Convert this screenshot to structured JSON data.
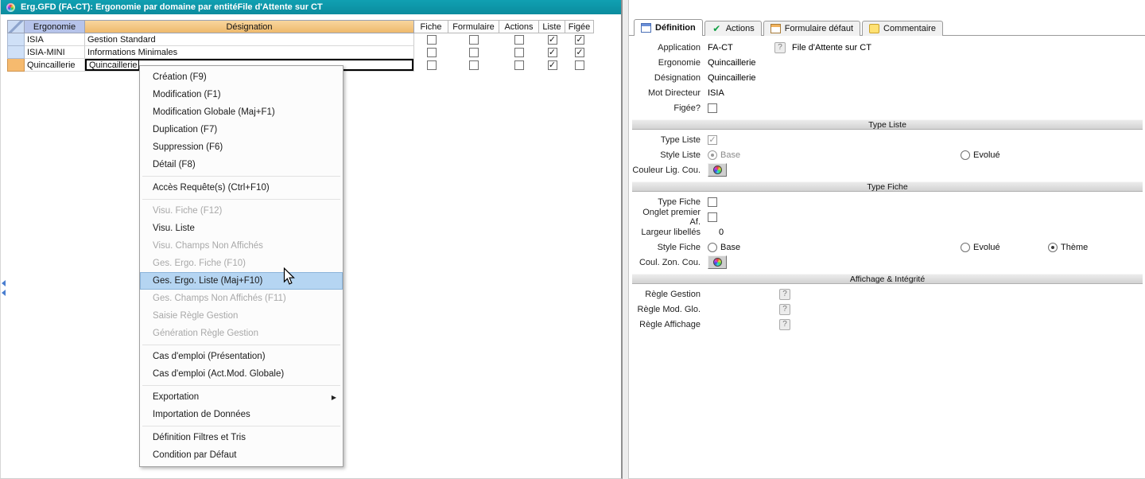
{
  "window": {
    "title": "Erg.GFD (FA-CT): Ergonomie par domaine par entitéFile d'Attente sur CT"
  },
  "glyphs": {
    "check": "✓",
    "check_bold": "✔",
    "submenu_arrow": "▶",
    "help": "?"
  },
  "table": {
    "columns": [
      "Ergonomie",
      "Désignation",
      "Fiche",
      "Formulaire",
      "Actions",
      "Liste",
      "Figée"
    ],
    "rows": [
      {
        "ergonomie": "ISIA",
        "designation": "Gestion Standard",
        "fiche": false,
        "formulaire": false,
        "actions": false,
        "liste": true,
        "figee": true,
        "selected": false,
        "editing": false
      },
      {
        "ergonomie": "ISIA-MINI",
        "designation": "Informations Minimales",
        "fiche": false,
        "formulaire": false,
        "actions": false,
        "liste": true,
        "figee": true,
        "selected": false,
        "editing": false
      },
      {
        "ergonomie": "Quincaillerie",
        "designation": "Quincaillerie",
        "fiche": false,
        "formulaire": false,
        "actions": false,
        "liste": true,
        "figee": false,
        "selected": true,
        "editing": true
      }
    ]
  },
  "context_menu": {
    "items": [
      {
        "label": "Création (F9)"
      },
      {
        "label": "Modification (F1)"
      },
      {
        "label": "Modification Globale (Maj+F1)"
      },
      {
        "label": "Duplication (F7)"
      },
      {
        "label": "Suppression (F6)"
      },
      {
        "label": "Détail (F8)"
      },
      {
        "separator": true
      },
      {
        "label": "Accès Requête(s) (Ctrl+F10)"
      },
      {
        "separator": true
      },
      {
        "label": "Visu. Fiche (F12)",
        "disabled": true
      },
      {
        "label": "Visu. Liste"
      },
      {
        "label": "Visu. Champs Non Affichés",
        "disabled": true
      },
      {
        "label": "Ges. Ergo. Fiche (F10)",
        "disabled": true
      },
      {
        "label": "Ges. Ergo. Liste (Maj+F10)",
        "highlighted": true
      },
      {
        "label": "Ges. Champs Non Affichés (F11)",
        "disabled": true
      },
      {
        "label": "Saisie Règle Gestion",
        "disabled": true
      },
      {
        "label": "Génération Règle Gestion",
        "disabled": true
      },
      {
        "separator": true
      },
      {
        "label": "Cas d'emploi (Présentation)"
      },
      {
        "label": "Cas d'emploi (Act.Mod. Globale)"
      },
      {
        "separator": true
      },
      {
        "label": "Exportation",
        "submenu": true
      },
      {
        "label": "Importation de Données"
      },
      {
        "separator": true
      },
      {
        "label": "Définition Filtres et Tris"
      },
      {
        "label": "Condition par Défaut"
      }
    ]
  },
  "tabs": [
    {
      "id": "definition",
      "label": "Définition",
      "icon": "definition-icon",
      "active": true
    },
    {
      "id": "actions",
      "label": "Actions",
      "icon": "actions-check-icon",
      "active": false
    },
    {
      "id": "formulaire-defaut",
      "label": "Formulaire défaut",
      "icon": "form-icon",
      "active": false
    },
    {
      "id": "commentaire",
      "label": "Commentaire",
      "icon": "comment-icon",
      "active": false
    }
  ],
  "panel": {
    "rows": [
      {
        "type": "text",
        "label": "Application",
        "value": "FA-CT",
        "help": true,
        "extra": "File d'Attente sur CT"
      },
      {
        "type": "text",
        "label": "Ergonomie",
        "value": "Quincaillerie"
      },
      {
        "type": "text",
        "label": "Désignation",
        "value": "Quincaillerie"
      },
      {
        "type": "text",
        "label": "Mot Directeur",
        "value": "ISIA"
      },
      {
        "type": "checkbox",
        "label": "Figée?",
        "checked": false
      },
      {
        "type": "section",
        "label": "Type Liste"
      },
      {
        "type": "checkbox",
        "label": "Type Liste",
        "checked": true,
        "disabled": true
      },
      {
        "type": "radios",
        "label": "Style Liste",
        "options": [
          {
            "label": "Base",
            "on": true,
            "disabled": true,
            "pos": 0
          },
          {
            "label": "Evolué",
            "on": false,
            "pos": 1
          }
        ]
      },
      {
        "type": "color",
        "label": "Couleur Lig. Cou."
      },
      {
        "type": "section",
        "label": "Type Fiche"
      },
      {
        "type": "checkbox",
        "label": "Type Fiche",
        "checked": false
      },
      {
        "type": "checkbox",
        "label": "Onglet premier Af.",
        "checked": false
      },
      {
        "type": "text",
        "label": "Largeur libellés",
        "value": "0",
        "indent": 14
      },
      {
        "type": "radios",
        "label": "Style Fiche",
        "options": [
          {
            "label": "Base",
            "on": false,
            "pos": 0
          },
          {
            "label": "Evolué",
            "on": false,
            "pos": 1
          },
          {
            "label": "Thème",
            "on": true,
            "pos": 2
          }
        ]
      },
      {
        "type": "color",
        "label": "Coul. Zon. Cou."
      },
      {
        "type": "section",
        "label": "Affichage & Intégrité"
      },
      {
        "type": "help",
        "label": "Règle Gestion"
      },
      {
        "type": "help",
        "label": "Règle Mod. Glo."
      },
      {
        "type": "help",
        "label": "Règle Affichage"
      }
    ]
  }
}
